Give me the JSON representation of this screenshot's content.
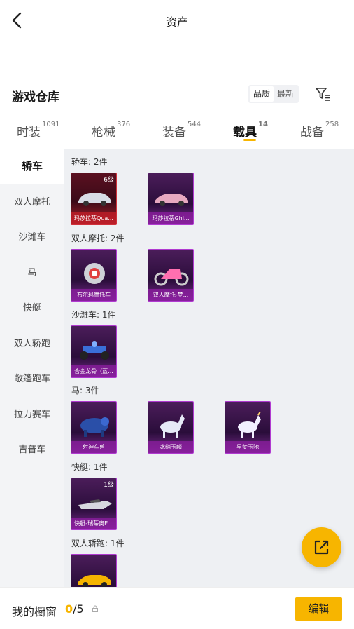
{
  "header": {
    "title": "资产",
    "back_icon": "chevron-left-icon"
  },
  "section": {
    "title": "游戏仓库",
    "sort_options": [
      "品质",
      "最新"
    ],
    "filter_icon": "filter-icon"
  },
  "tabs": [
    {
      "label": "时装",
      "count": "1091"
    },
    {
      "label": "枪械",
      "count": "376"
    },
    {
      "label": "装备",
      "count": "544"
    },
    {
      "label": "载具",
      "count": "14"
    },
    {
      "label": "战备",
      "count": "258"
    }
  ],
  "active_tab": "载具",
  "accent_color": "#f7b500",
  "sidebar": [
    "轿车",
    "双人摩托",
    "沙滩车",
    "马",
    "快艇",
    "双人轿跑",
    "敞篷跑车",
    "拉力赛车",
    "吉普车"
  ],
  "groups": [
    {
      "label": "轿车: 2件",
      "items": [
        {
          "name": "玛莎拉蒂Qua...",
          "level": "6级",
          "rarity": "red"
        },
        {
          "name": "玛莎拉蒂Ghi...",
          "level": "",
          "rarity": "purple"
        }
      ]
    },
    {
      "label": "双人摩托: 2件",
      "items": [
        {
          "name": "布尔玛摩托车",
          "level": "",
          "rarity": "purple"
        },
        {
          "name": "双人摩托-梦...",
          "level": "",
          "rarity": "purple"
        }
      ]
    },
    {
      "label": "沙滩车: 1件",
      "items": [
        {
          "name": "合金龙骨（蓝...",
          "level": "",
          "rarity": "purple"
        }
      ]
    },
    {
      "label": "马: 3件",
      "items": [
        {
          "name": "射神车兽",
          "level": "",
          "rarity": "purple"
        },
        {
          "name": "冰绡玉麟",
          "level": "",
          "rarity": "purple"
        },
        {
          "name": "星梦玉驰",
          "level": "",
          "rarity": "purple"
        }
      ]
    },
    {
      "label": "快艇: 1件",
      "items": [
        {
          "name": "快艇-瑞蒂奥E...",
          "level": "1级",
          "rarity": "purple"
        }
      ]
    },
    {
      "label": "双人轿跑: 1件",
      "items": [
        {
          "name": "",
          "level": "",
          "rarity": "purple"
        }
      ]
    }
  ],
  "fab_icon": "external-link-icon",
  "bottom": {
    "label": "我的橱窗",
    "current": "0",
    "total": "/5",
    "lock_icon": "lock-icon",
    "edit_label": "编辑"
  }
}
